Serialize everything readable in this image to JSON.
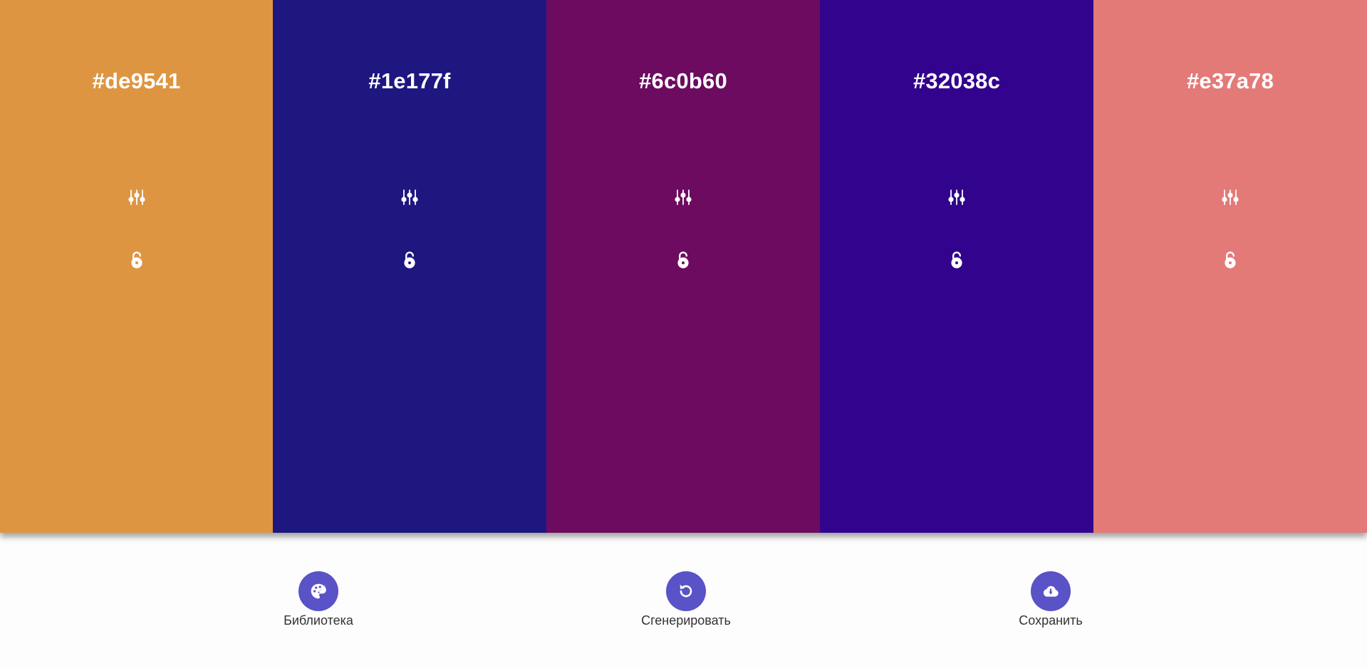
{
  "palette": {
    "colors": [
      {
        "hex": "#de9541",
        "adjust_icon": "sliders-icon",
        "lock_icon": "unlocked-icon",
        "locked": false
      },
      {
        "hex": "#1e177f",
        "adjust_icon": "sliders-icon",
        "lock_icon": "unlocked-icon",
        "locked": false
      },
      {
        "hex": "#6c0b60",
        "adjust_icon": "sliders-icon",
        "lock_icon": "unlocked-icon",
        "locked": false
      },
      {
        "hex": "#32038c",
        "adjust_icon": "sliders-icon",
        "lock_icon": "unlocked-icon",
        "locked": false
      },
      {
        "hex": "#e37a78",
        "adjust_icon": "sliders-icon",
        "lock_icon": "unlocked-icon",
        "locked": false
      }
    ]
  },
  "toolbar": {
    "accent": "#5a52c7",
    "library": {
      "label": "Библиотека",
      "icon": "palette-icon"
    },
    "generate": {
      "label": "Сгенерировать",
      "icon": "refresh-icon"
    },
    "save": {
      "label": "Сохранить",
      "icon": "cloud-download-icon"
    }
  }
}
